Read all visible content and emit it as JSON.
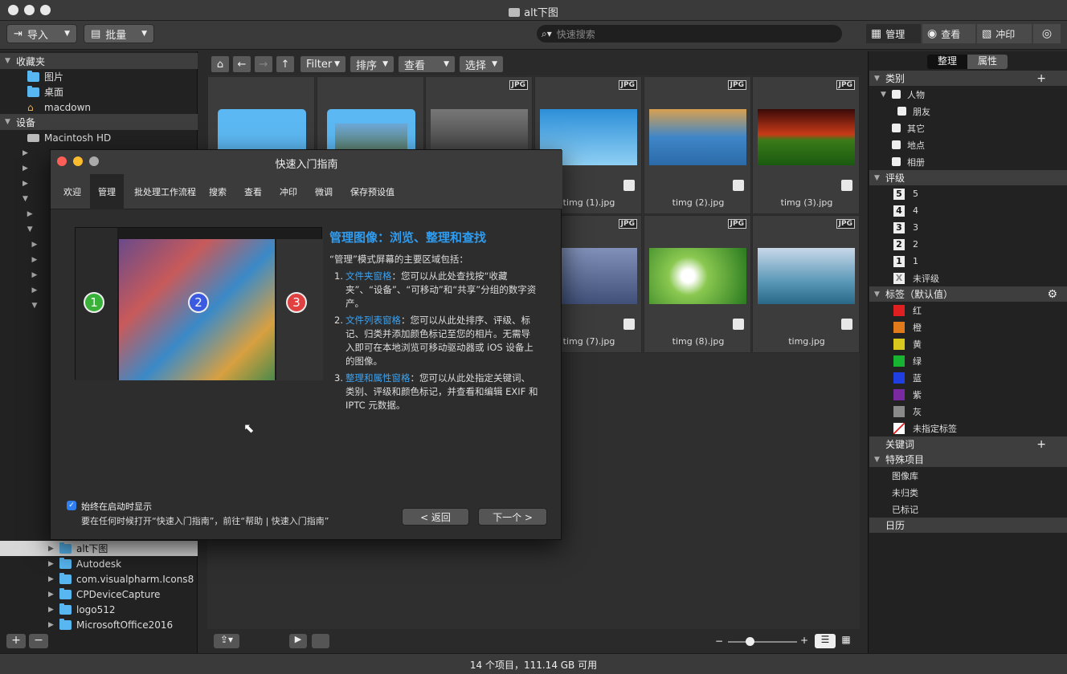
{
  "window": {
    "title": "alt下图"
  },
  "toolbar": {
    "import_label": "导入",
    "batch_label": "批量",
    "search_placeholder": "快速搜索",
    "modes": [
      {
        "label": "管理"
      },
      {
        "label": "查看"
      },
      {
        "label": "冲印"
      }
    ]
  },
  "sidebar": {
    "favorites_header": "收藏夹",
    "favorites": [
      "图片",
      "桌面",
      "macdown"
    ],
    "devices_header": "设备",
    "devices": [
      "Macintosh HD"
    ],
    "folders": [
      "alt下图",
      "Autodesk",
      "com.visualpharm.Icons8",
      "CPDeviceCapture",
      "logo512",
      "MicrosoftOffice2016"
    ],
    "add": "+",
    "remove": "−"
  },
  "nav": {
    "filter": "Filter",
    "sort": "排序",
    "view": "查看",
    "select": "选择"
  },
  "grid": {
    "badge": "JPG",
    "files": [
      "timg (1).jpg",
      "timg (2).jpg",
      "timg (3).jpg",
      "timg (7).jpg",
      "timg (8).jpg",
      "timg.jpg"
    ]
  },
  "right_panel": {
    "tabs": [
      "整理",
      "属性"
    ],
    "category_header": "类别",
    "categories": [
      "人物",
      "朋友",
      "其它",
      "地点",
      "相册"
    ],
    "rating_header": "评级",
    "ratings": [
      {
        "box": "5",
        "label": "5"
      },
      {
        "box": "4",
        "label": "4"
      },
      {
        "box": "3",
        "label": "3"
      },
      {
        "box": "2",
        "label": "2"
      },
      {
        "box": "1",
        "label": "1"
      },
      {
        "box": "X",
        "label": "未评级"
      }
    ],
    "labels_header": "标签（默认值）",
    "labels": [
      {
        "name": "红",
        "color": "#e02020"
      },
      {
        "name": "橙",
        "color": "#e07a1a"
      },
      {
        "name": "黄",
        "color": "#d8c81e"
      },
      {
        "name": "绿",
        "color": "#18b330"
      },
      {
        "name": "蓝",
        "color": "#1f3fe0"
      },
      {
        "name": "紫",
        "color": "#7a2aa0"
      },
      {
        "name": "灰",
        "color": "#8a8a8a"
      },
      {
        "name": "未指定标签",
        "color": "#ffffff"
      }
    ],
    "keywords_header": "关键词",
    "special_header": "特殊项目",
    "special": [
      "图像库",
      "未归类",
      "已标记"
    ],
    "calendar_header": "日历"
  },
  "status": {
    "text": "14 个项目，111.14 GB 可用"
  },
  "dialog": {
    "title": "快速入门指南",
    "tabs": [
      "欢迎",
      "管理",
      "批处理工作流程",
      "搜索",
      "查看",
      "冲印",
      "微调",
      "保存预设值"
    ],
    "heading": "管理图像：浏览、整理和查找",
    "intro": "“管理”模式屏幕的主要区域包括：",
    "items": [
      {
        "num": "1.",
        "title": "文件夹窗格",
        "text": "：您可以从此处查找按“收藏夹”、“设备”、“可移动”和“共享”分组的数字资产。"
      },
      {
        "num": "2.",
        "title": "文件列表窗格",
        "text": "：您可以从此处排序、评级、标记、归类并添加颜色标记至您的相片。无需导入即可在本地浏览可移动驱动器或 iOS 设备上的图像。"
      },
      {
        "num": "3.",
        "title": "整理和属性窗格",
        "text": "：您可以从此处指定关键词、类别、评级和颜色标记，并查看和编辑 EXIF 和 IPTC 元数据。"
      }
    ],
    "badges": [
      "1",
      "2",
      "3"
    ],
    "checkbox_label": "始终在启动时显示",
    "hint": "要在任何时候打开“快速入门指南”，前往“帮助 | 快速入门指南”",
    "back": "< 返回",
    "next": "下一个 >"
  }
}
